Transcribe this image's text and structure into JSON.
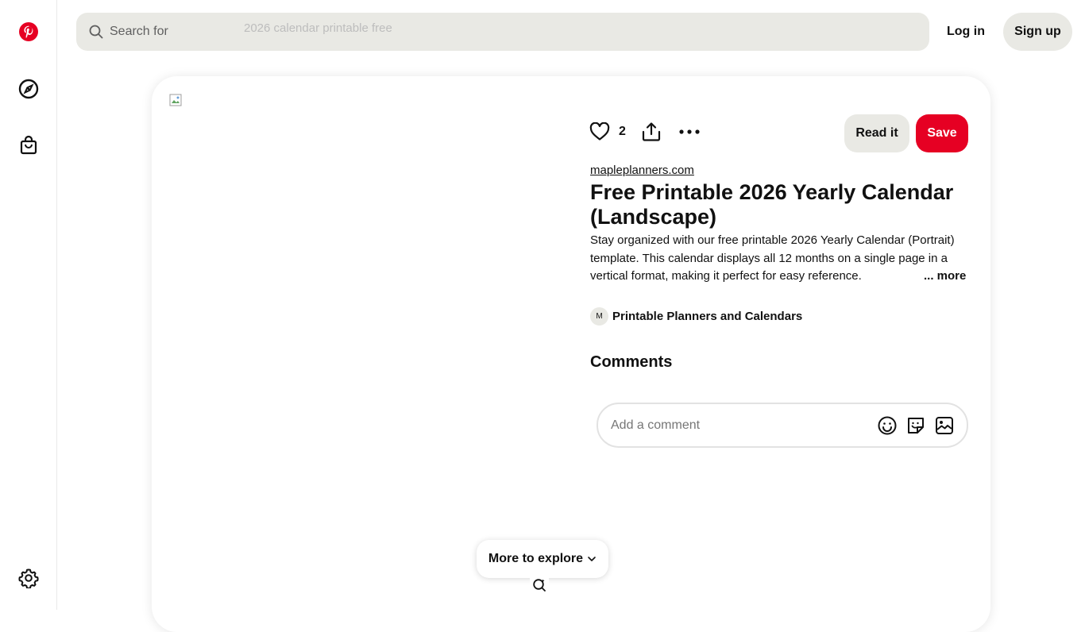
{
  "header": {
    "search_placeholder": "Search for",
    "search_ghost_text": "2026 calendar printable free",
    "login_label": "Log in",
    "signup_label": "Sign up"
  },
  "sidebar": {
    "items": [
      {
        "name": "pinterest-logo-icon"
      },
      {
        "name": "explore-compass-icon"
      },
      {
        "name": "shopping-bag-icon"
      },
      {
        "name": "settings-gear-icon"
      }
    ]
  },
  "pin": {
    "like_count": "2",
    "read_it_label": "Read it",
    "save_label": "Save",
    "source": "mapleplanners.com",
    "title": "Free Printable 2026 Yearly Calendar (Landscape)",
    "description": "Stay organized with our free printable 2026 Yearly Calendar (Portrait) template. This calendar displays all 12 months on a single page in a vertical format, making it perfect for easy reference.",
    "more_label": "... more",
    "board_avatar_letter": "M",
    "board_name": "Printable Planners and Calendars"
  },
  "comments": {
    "title": "Comments",
    "placeholder": "Add a comment"
  },
  "explore": {
    "label": "More to explore"
  },
  "colors": {
    "brand_red": "#e60023",
    "button_gray": "#e9e9e4"
  }
}
